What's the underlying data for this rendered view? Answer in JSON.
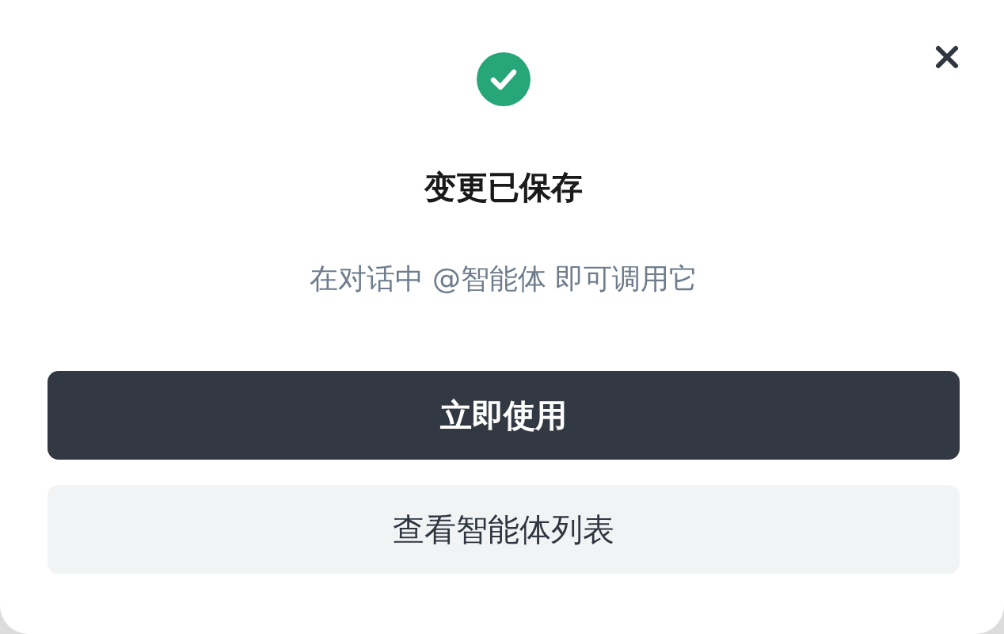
{
  "dialog": {
    "title": "变更已保存",
    "message": "在对话中 @智能体 即可调用它",
    "buttons": [
      {
        "label": "立即使用",
        "kind": "primary"
      },
      {
        "label": "查看智能体列表",
        "kind": "secondary"
      }
    ]
  }
}
